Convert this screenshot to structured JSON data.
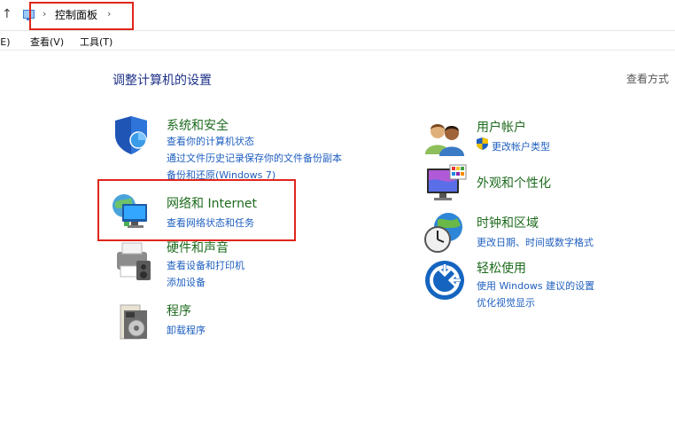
{
  "address_bar": {
    "up_arrow": "↑",
    "breadcrumb": "控制面板",
    "chevron1": "›",
    "chevron2": "›"
  },
  "menu": {
    "edit": "编辑(E)",
    "view": "查看(V)",
    "tools": "工具(T)"
  },
  "heading": "调整计算机的设置",
  "view_by": "查看方式",
  "categories": {
    "system_security": {
      "title": "系统和安全",
      "links": [
        "查看你的计算机状态",
        "通过文件历史记录保存你的文件备份副本",
        "备份和还原(Windows 7)"
      ]
    },
    "network_internet": {
      "title": "网络和 Internet",
      "links": [
        "查看网络状态和任务"
      ]
    },
    "hardware_sound": {
      "title": "硬件和声音",
      "links": [
        "查看设备和打印机",
        "添加设备"
      ]
    },
    "programs": {
      "title": "程序",
      "links": [
        "卸载程序"
      ]
    },
    "user_accounts": {
      "title": "用户帐户",
      "links": [
        "更改帐户类型"
      ]
    },
    "appearance": {
      "title": "外观和个性化",
      "links": []
    },
    "clock_region": {
      "title": "时钟和区域",
      "links": [
        "更改日期、时间或数字格式"
      ]
    },
    "ease_of_access": {
      "title": "轻松使用",
      "links": [
        "使用 Windows 建议的设置",
        "优化视觉显示"
      ]
    }
  },
  "colors": {
    "accent_red": "#e0251b",
    "title_green": "#1e6b1e",
    "link_blue": "#1f5fbf",
    "heading_blue": "#1e3287"
  }
}
